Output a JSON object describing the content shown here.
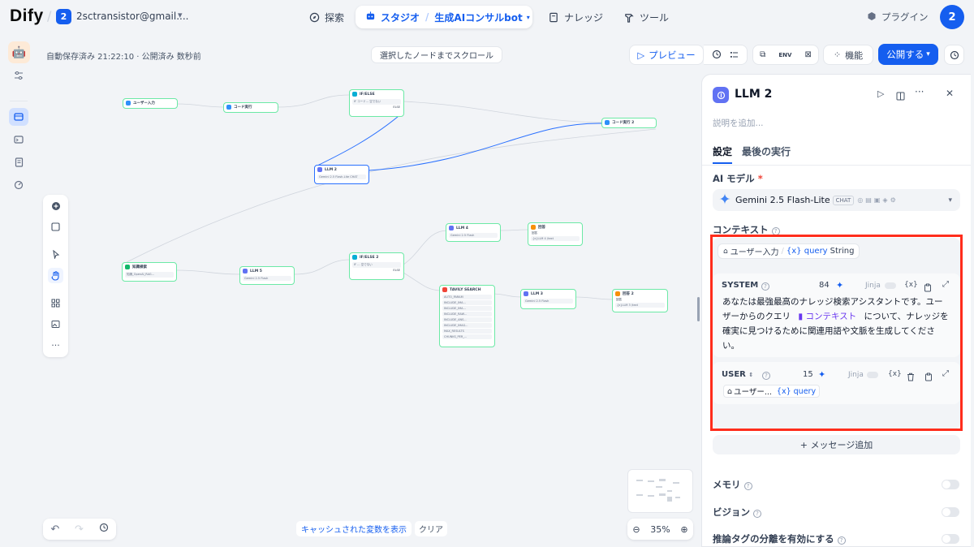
{
  "header": {
    "logo": "Dify",
    "workspace_badge": "2",
    "workspace_name": "2sctransistor@gmail....",
    "nav": {
      "explore": "探索",
      "studio": "スタジオ",
      "app_name": "生成AIコンサルbot",
      "knowledge": "ナレッジ",
      "tools": "ツール"
    },
    "plugin": "プラグイン",
    "avatar": "2"
  },
  "canvas": {
    "autosave": "自動保存済み 21:22:10 · 公開済み 数秒前",
    "scroll_to_node": "選択したノードまでスクロール",
    "preview": "プレビュー",
    "features": "機能",
    "publish": "公開する",
    "cache_vars": "キャッシュされた変数を表示",
    "clear": "クリア",
    "zoom": "35%"
  },
  "nodes": [
    {
      "title": "ユーザー入力",
      "rows": []
    },
    {
      "title": "コード実行",
      "rows": []
    },
    {
      "title": "IF/ELSE",
      "rows": [
        "IF コード… 空でない",
        "ELSE"
      ]
    },
    {
      "title": "コード実行 2",
      "rows": []
    },
    {
      "title": "LLM 2",
      "rows": [
        "Gemini 2.5 Flash-Lite CHAT"
      ]
    },
    {
      "title": "知識検索",
      "rows": [
        "知識_OpenAI_RAG..."
      ]
    },
    {
      "title": "LLM 5",
      "rows": [
        "Gemini 2.5 Flash"
      ]
    },
    {
      "title": "IF/ELSE 2",
      "rows": [
        "IF … 空でない",
        "ELSE"
      ]
    },
    {
      "title": "LLM 4",
      "rows": [
        "Gemini 2.5 Flash"
      ]
    },
    {
      "title": "回答",
      "rows": [
        "回答",
        "{x}LLM 4 /text"
      ]
    },
    {
      "title": "TAVILY SEARCH",
      "rows": [
        "AUTO_PARAM",
        "INCLUDE_IMA...",
        "INCLUDE_IMA...",
        "INCLUDE_RAW...",
        "INCLUDE_ANS...",
        "INCLUDE_IMAG...",
        "MAX_RESULTS",
        "CHUNKS_PER_..."
      ]
    },
    {
      "title": "LLM 3",
      "rows": [
        "Gemini 2.5 Flash"
      ]
    },
    {
      "title": "回答 2",
      "rows": [
        "回答",
        "{x}LLM 3 /text"
      ]
    }
  ],
  "panel": {
    "title": "LLM 2",
    "description_placeholder": "説明を追加...",
    "tabs": [
      "設定",
      "最後の実行"
    ],
    "model_label": "AI モデル",
    "required_mark": "*",
    "model_name": "Gemini 2.5 Flash-Lite",
    "model_chip": "CHAT",
    "context_label": "コンテキスト",
    "context_var": {
      "source": "ユーザー入力",
      "sep": "/",
      "var": "{x} query",
      "type": "String"
    },
    "system": {
      "label": "SYSTEM",
      "count": "84",
      "jinja": "Jinja",
      "var_icon": "{x}",
      "line1": "あなたは最強最高のナレッジ検索アシスタントです。ユー",
      "line2_a": "ザーからのクエリ",
      "line2_ctx": "コンテキスト",
      "line2_b": "について、ナレッジを",
      "line3": "確実に見つけるために関連用語や文脈を生成してくださ",
      "line4": "い。"
    },
    "user": {
      "label": "USER",
      "count": "15",
      "jinja": "Jinja",
      "var_icon": "{x}",
      "var_source": "ユーザー...",
      "var_name": "{x} query"
    },
    "add_message": "+ メッセージ追加",
    "memory": "メモリ",
    "vision": "ビジョン",
    "reasoning": "推論タグの分離を有効にする"
  },
  "colors": {
    "accent": "#155eef",
    "highlight": "#ff2d1c",
    "node_border": "#6ce9a6",
    "llm_icon": "#6172f3"
  }
}
